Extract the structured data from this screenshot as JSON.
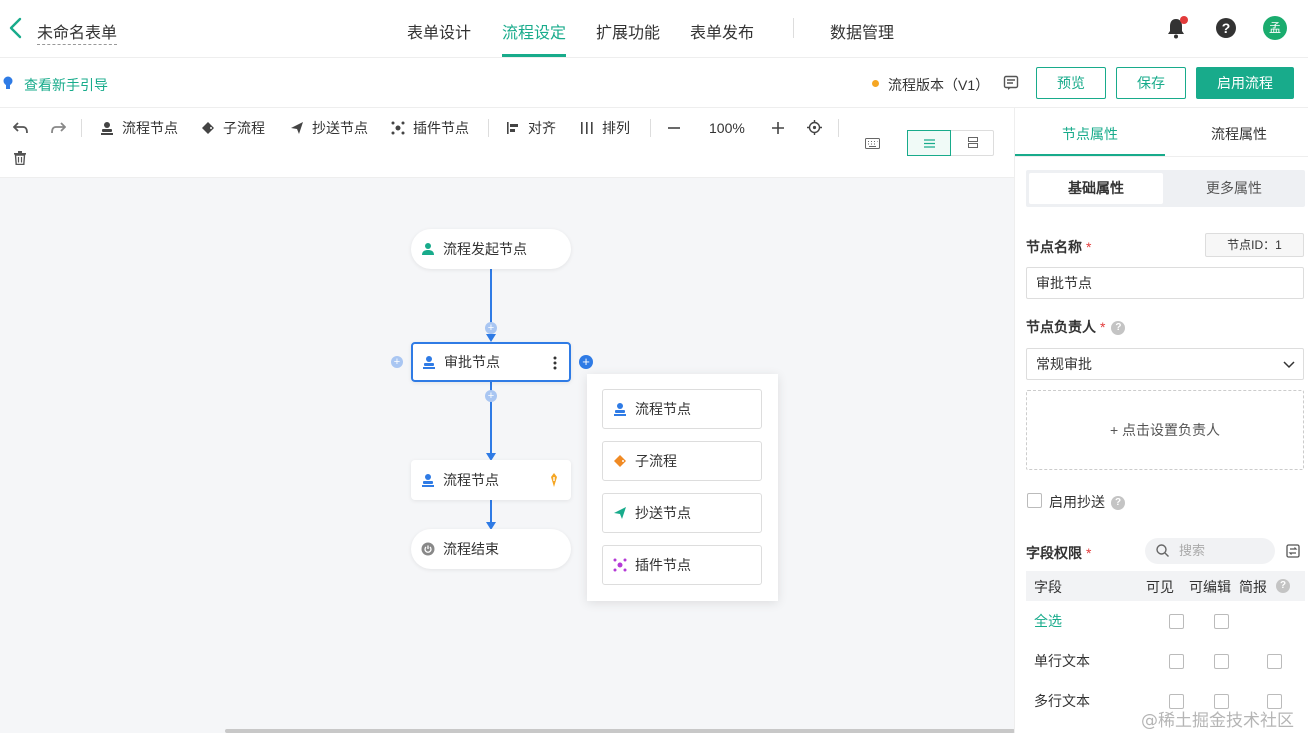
{
  "header": {
    "form_title": "未命名表单",
    "tabs": [
      "表单设计",
      "流程设定",
      "扩展功能",
      "表单发布",
      "数据管理"
    ],
    "active_tab": "流程设定",
    "avatar_text": "孟"
  },
  "subbar": {
    "guide_link": "查看新手引导",
    "version_label": "流程版本（V1）",
    "buttons": {
      "preview": "预览",
      "save": "保存",
      "enable": "启用流程"
    }
  },
  "toolbar": {
    "items": {
      "flow_node": "流程节点",
      "subflow": "子流程",
      "cc_node": "抄送节点",
      "plugin_node": "插件节点",
      "align": "对齐",
      "arrange": "排列"
    },
    "zoom": "100%"
  },
  "canvas": {
    "nodes": {
      "start": "流程发起节点",
      "approval": "审批节点",
      "flow": "流程节点",
      "end": "流程结束"
    },
    "popup": [
      "流程节点",
      "子流程",
      "抄送节点",
      "插件节点"
    ]
  },
  "panel": {
    "tabs": [
      "节点属性",
      "流程属性"
    ],
    "segments": [
      "基础属性",
      "更多属性"
    ],
    "node_name_label": "节点名称",
    "node_id": "节点ID：1",
    "node_name_value": "审批节点",
    "owner_label": "节点负责人",
    "owner_select": "常规审批",
    "assign_text": "+ 点击设置负责人",
    "cc_label": "启用抄送",
    "field_perm_label": "字段权限",
    "search_placeholder": "搜索",
    "table": {
      "headers": [
        "字段",
        "可见",
        "可编辑",
        "简报"
      ],
      "rows": [
        "全选",
        "单行文本",
        "多行文本"
      ]
    }
  },
  "watermark": "@稀土掘金技术社区",
  "colors": {
    "accent": "#18ab8b",
    "flow_blue": "#2f7be5",
    "warning": "#f5a623"
  }
}
